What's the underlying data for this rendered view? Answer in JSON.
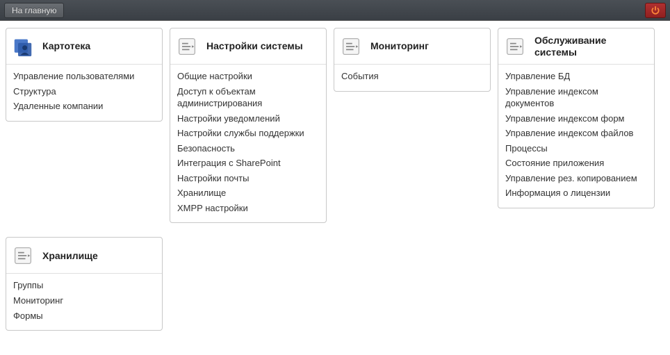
{
  "toolbar": {
    "home_label": "На главную"
  },
  "cards": [
    {
      "id": "kartoteka",
      "title": "Картотека",
      "icon": "people-icon",
      "items": [
        "Управление пользователями",
        "Структура",
        "Удаленные компании"
      ]
    },
    {
      "id": "settings",
      "title": "Настройки системы",
      "icon": "doc-icon",
      "items": [
        "Общие настройки",
        "Доступ к объектам администрирования",
        "Настройки уведомлений",
        "Настройки службы поддержки",
        "Безопасность",
        "Интеграция с SharePoint",
        "Настройки почты",
        "Хранилище",
        "XMPP настройки"
      ]
    },
    {
      "id": "monitoring",
      "title": "Мониторинг",
      "icon": "doc-icon",
      "items": [
        "События"
      ]
    },
    {
      "id": "service",
      "title": "Обслуживание системы",
      "icon": "doc-icon",
      "items": [
        "Управление БД",
        "Управление индексом документов",
        "Управление индексом форм",
        "Управление индексом файлов",
        "Процессы",
        "Состояние приложения",
        "Управление рез. копированием",
        "Информация о лицензии"
      ]
    },
    {
      "id": "storage",
      "title": "Хранилище",
      "icon": "doc-icon",
      "items": [
        "Группы",
        "Мониторинг",
        "Формы"
      ]
    }
  ]
}
